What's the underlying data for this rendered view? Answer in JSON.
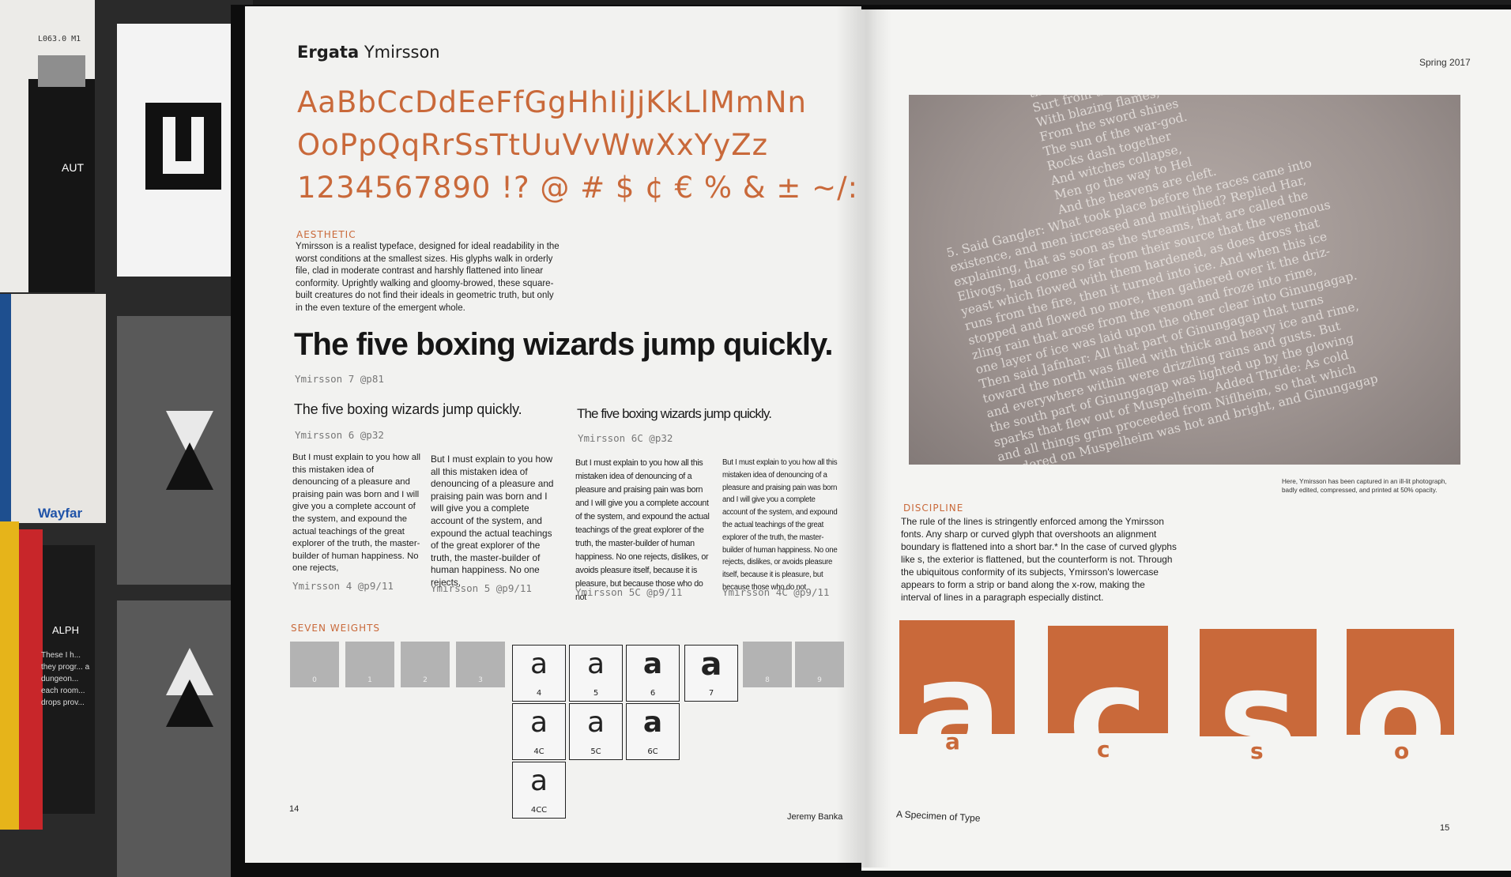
{
  "left_page": {
    "heading_bold": "Ergata",
    "heading_light": "Ymirsson",
    "glyph_lines": [
      "AaBbCcDdEeFfGgHhIiJjKkLlMmNn",
      "OoPpQqRrSsTtUuVvWwXxYyZz",
      "1234567890 !? @ # $ ¢ € % & ± ~/:"
    ],
    "aesthetic_label": "AESTHETIC",
    "aesthetic_text": "Ymirsson is a realist typeface, designed for ideal readability in the worst conditions at the smallest sizes. His glyphs walk in orderly file, clad in moderate contrast and harshly flattened into linear conformity. Uprightly walking and gloomy-browed, these square-built creatures do not find their ideals in geometric truth, but only in the even texture of the emergent whole.",
    "display_line": "The five boxing wizards jump quickly.",
    "display_caption": "Ymirsson 7 @p81",
    "sub_a_text": "The five boxing wizards jump quickly.",
    "sub_a_caption": "Ymirsson 6 @p32",
    "sub_b_text": "The five boxing wizards jump quickly.",
    "sub_b_caption": "Ymirsson 6C @p32",
    "columns": [
      {
        "text": "But I must explain to you how all this mistaken idea of denouncing of a pleasure and praising pain was born and I will give you a complete account of the system, and expound the actual teachings of the great explorer of the truth, the master-builder of human happiness. No one rejects,",
        "caption": "Ymirsson 4 @p9/11"
      },
      {
        "text": "But I must explain to you how all this mistaken idea of denouncing of a pleasure and praising pain was born and I will give you a complete account of the system, and expound the actual teachings of the great explorer of the truth, the master-builder of human happiness. No one rejects,",
        "caption": "Ymirsson 5 @p9/11"
      },
      {
        "text": "But I must explain to you how all this mistaken idea of denouncing of a pleasure and praising pain was born and I will give you a complete account of the system, and expound the actual teachings of the great explorer of the truth, the master-builder of human happiness. No one rejects, dislikes, or avoids pleasure itself, because it is pleasure, but because those who do not",
        "caption": "Ymirsson 5C @p9/11"
      },
      {
        "text": "But I must explain to you how all this mistaken idea of denouncing of a pleasure and praising pain was born and I will give you a complete account of the system, and expound the actual teachings of the great explorer of the truth, the master-builder of human happiness. No one rejects, dislikes, or avoids pleasure itself, because it is pleasure, but because those who do not",
        "caption": "Ymirsson 4C @p9/11"
      }
    ],
    "weights_label": "SEVEN WEIGHTS",
    "grey_weights": [
      "0",
      "1",
      "2",
      "3",
      "8",
      "9"
    ],
    "weight_boxes": [
      {
        "glyph": "a",
        "label": "4"
      },
      {
        "glyph": "a",
        "label": "5"
      },
      {
        "glyph": "a",
        "label": "6"
      },
      {
        "glyph": "a",
        "label": "7"
      },
      {
        "glyph": "a",
        "label": "4C"
      },
      {
        "glyph": "a",
        "label": "5C"
      },
      {
        "glyph": "a",
        "label": "6C"
      },
      {
        "glyph": "a",
        "label": "4CC"
      }
    ],
    "page_number": "14",
    "author": "Jeremy Banka"
  },
  "right_page": {
    "season": "Spring 2017",
    "photo_lines": [
      "the Vala ...",
      "Surt from the south",
      "With blazing flames;",
      "From the sword shines",
      "The sun of the war-god.",
      "Rocks dash together",
      "And witches collapse,",
      "Men go the way to Hel",
      "And the heavens are cleft.",
      "5. Said Gangler: What took place before the races came into",
      "existence, and men increased and multiplied? Replied Har,",
      "explaining, that as soon as the streams, that are called the",
      "Elivogs, had come so far from their source that the venomous",
      "yeast which flowed with them hardened, as does dross that",
      "runs from the fire, then it turned into ice. And when this ice",
      "stopped and flowed no more, then gathered over it the driz-",
      "zling rain that arose from the venom and froze into rime,",
      "one layer of ice was laid upon the other clear into Ginungagap.",
      "Then said Jafnhar: All that part of Ginungagap that turns",
      "toward the north was filled with thick and heavy ice and rime,",
      "and everywhere within were drizzling rains and gusts. But",
      "the south part of Ginungagap was lighted up by the glowing",
      "sparks that flew out of Muspelheim. Added Thride: As cold",
      "and all things grim proceeded from Niflheim, so that which",
      "bordered on Muspelheim was hot and bright, and Ginungagap"
    ],
    "photo_caption": "Here, Ymirsson has been captured in an ill-lit photograph, badly edited, compressed, and printed at 50% opacity.",
    "discipline_label": "DISCIPLINE",
    "discipline_text": "The rule of the lines is stringently enforced among the Ymirsson fonts. Any sharp or curved glyph that overshoots an alignment boundary is flattened into a short bar.* In the case of curved glyphs like s, the exterior is flattened, but the counterform is not. Through the ubiquitous conformity of its subjects, Ymirsson's lowercase appears to form a strip or band along the x-row, making the interval of lines in a paragraph especially distinct.",
    "tiles": [
      {
        "big": "a",
        "small": "a"
      },
      {
        "big": "c",
        "small": "c"
      },
      {
        "big": "s",
        "small": "s"
      },
      {
        "big": "o",
        "small": "o"
      }
    ],
    "footer": "A Specimen of Type",
    "page_number": "15"
  },
  "background_fragments": {
    "top_left_code": "L063.0  M1",
    "label_aut": "AUT",
    "label_wayfar": "Wayfar",
    "label_alph": "ALPH",
    "alph_text": "These I h... they progr... a dungeon... each room... drops prov..."
  },
  "colors": {
    "accent": "#c9693a",
    "page": "#f2f2f0",
    "ink": "#1e1e1e"
  }
}
